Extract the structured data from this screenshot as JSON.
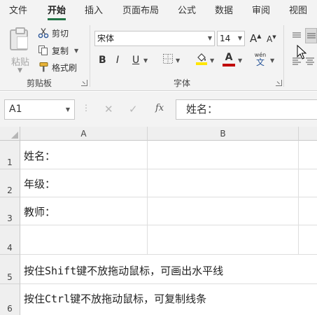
{
  "menu": [
    "文件",
    "开始",
    "插入",
    "页面布局",
    "公式",
    "数据",
    "审阅",
    "视图"
  ],
  "clipboard": {
    "paste_label": "粘贴",
    "cut_label": "剪切",
    "copy_label": "复制",
    "format_painter_label": "格式刷",
    "group_label": "剪贴板"
  },
  "font": {
    "family": "宋体",
    "size": "14",
    "bold_glyph": "B",
    "italic_glyph": "I",
    "underline_glyph": "U",
    "grow_glyph": "A",
    "shrink_glyph": "A",
    "font_color_glyph": "A",
    "phonetic_glyph": "wén",
    "phonetic_sub": "文",
    "group_label": "字体"
  },
  "formula_bar": {
    "cell_ref": "A1",
    "fx_label": "fx",
    "cancel_glyph": "✕",
    "enter_glyph": "✓",
    "content": "姓名："
  },
  "sheet": {
    "columns": [
      "A",
      "B"
    ],
    "rows": [
      "1",
      "2",
      "3",
      "4",
      "5",
      "6"
    ],
    "cells": {
      "A1": "姓名：",
      "A2": "年级：",
      "A3": "教师："
    },
    "overflow_rows": {
      "r5": "按住Shift键不放拖动鼠标，可画出水平线",
      "r6": "按住Ctrl键不放拖动鼠标，可复制线条"
    }
  },
  "colors": {
    "accent": "#217346",
    "highlight_yellow": "#ffe600",
    "font_color_bar": "#c00000"
  }
}
